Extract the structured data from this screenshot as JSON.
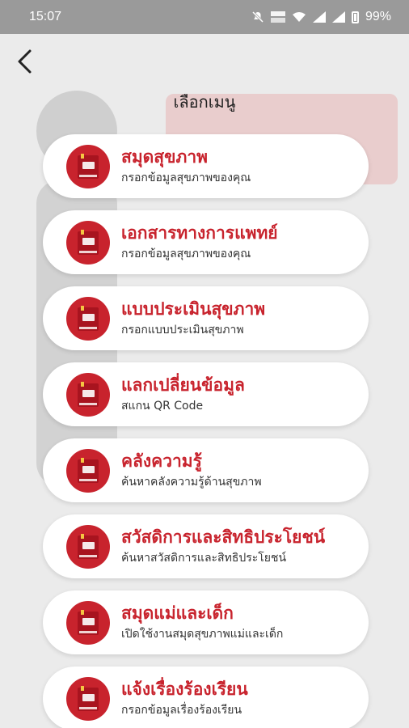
{
  "status": {
    "time": "15:07",
    "battery": "99%"
  },
  "header": {
    "title": "เลือกเมนู"
  },
  "menu": [
    {
      "title": "สมุดสุขภาพ",
      "subtitle": "กรอกข้อมูลสุขภาพของคุณ"
    },
    {
      "title": "เอกสารทางการแพทย์",
      "subtitle": "กรอกข้อมูลสุขภาพของคุณ"
    },
    {
      "title": "แบบประเมินสุขภาพ",
      "subtitle": "กรอกแบบประเมินสุขภาพ"
    },
    {
      "title": "แลกเปลี่ยนข้อมูล",
      "subtitle": "สแกน QR Code"
    },
    {
      "title": "คลังความรู้",
      "subtitle": "ค้นหาคลังความรู้ด้านสุขภาพ"
    },
    {
      "title": "สวัสดิการและสิทธิประโยชน์",
      "subtitle": "ค้นหาสวัสดิการและสิทธิประโยชน์"
    },
    {
      "title": "สมุดแม่และเด็ก",
      "subtitle": "เปิดใช้งานสมุดสุขภาพแม่และเด็ก"
    },
    {
      "title": "แจ้งเรื่องร้องเรียน",
      "subtitle": "กรอกข้อมูลเรื่องร้องเรียน"
    }
  ],
  "colors": {
    "accent": "#c8232d",
    "statusbar": "#9a9a9a"
  }
}
